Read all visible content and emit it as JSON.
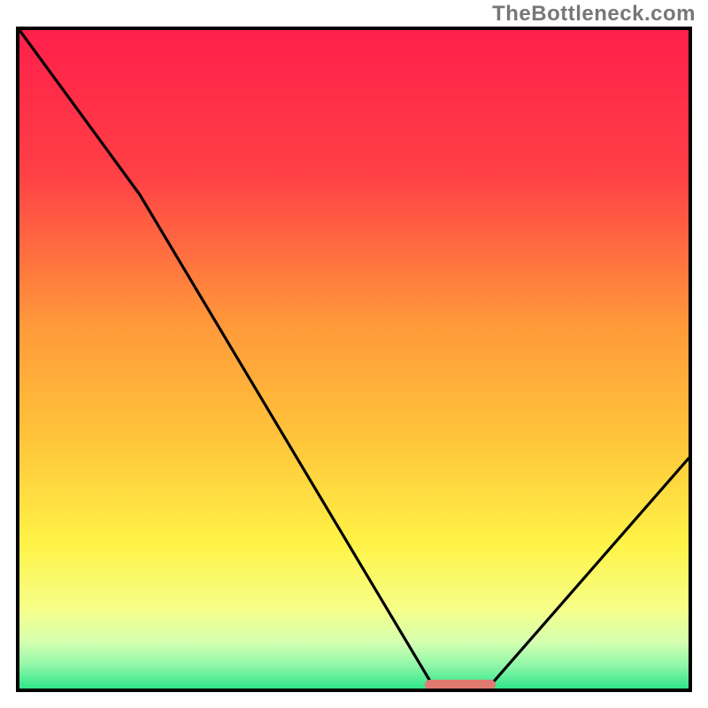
{
  "watermark": "TheBottleneck.com",
  "colors": {
    "frame": "#000000",
    "gradient_stops": [
      {
        "pos": 0.0,
        "color": "#ff1f4a"
      },
      {
        "pos": 0.22,
        "color": "#ff4046"
      },
      {
        "pos": 0.45,
        "color": "#ff9a3a"
      },
      {
        "pos": 0.62,
        "color": "#ffc43a"
      },
      {
        "pos": 0.78,
        "color": "#fff347"
      },
      {
        "pos": 0.88,
        "color": "#f6ff8a"
      },
      {
        "pos": 0.93,
        "color": "#d4ffb0"
      },
      {
        "pos": 0.965,
        "color": "#8ff7a8"
      },
      {
        "pos": 1.0,
        "color": "#2fe58a"
      }
    ],
    "marker": "#e07a70",
    "curve": "#000000"
  },
  "chart_data": {
    "type": "line",
    "title": "",
    "xlabel": "",
    "ylabel": "",
    "xlim": [
      0,
      100
    ],
    "ylim": [
      0,
      100
    ],
    "x": [
      0,
      18,
      62,
      70,
      100
    ],
    "values": [
      100,
      75,
      0,
      0,
      35
    ],
    "marker": {
      "x_start": 61,
      "x_end": 71,
      "y": 0
    },
    "notes": "Gradient background runs red (top, y=100) through orange/yellow to green (bottom, y=0). Curve shows a steep V reaching y=0 around x≈62–70, then rising to the right. A small salmon capsule marks the trough on the x-axis."
  }
}
